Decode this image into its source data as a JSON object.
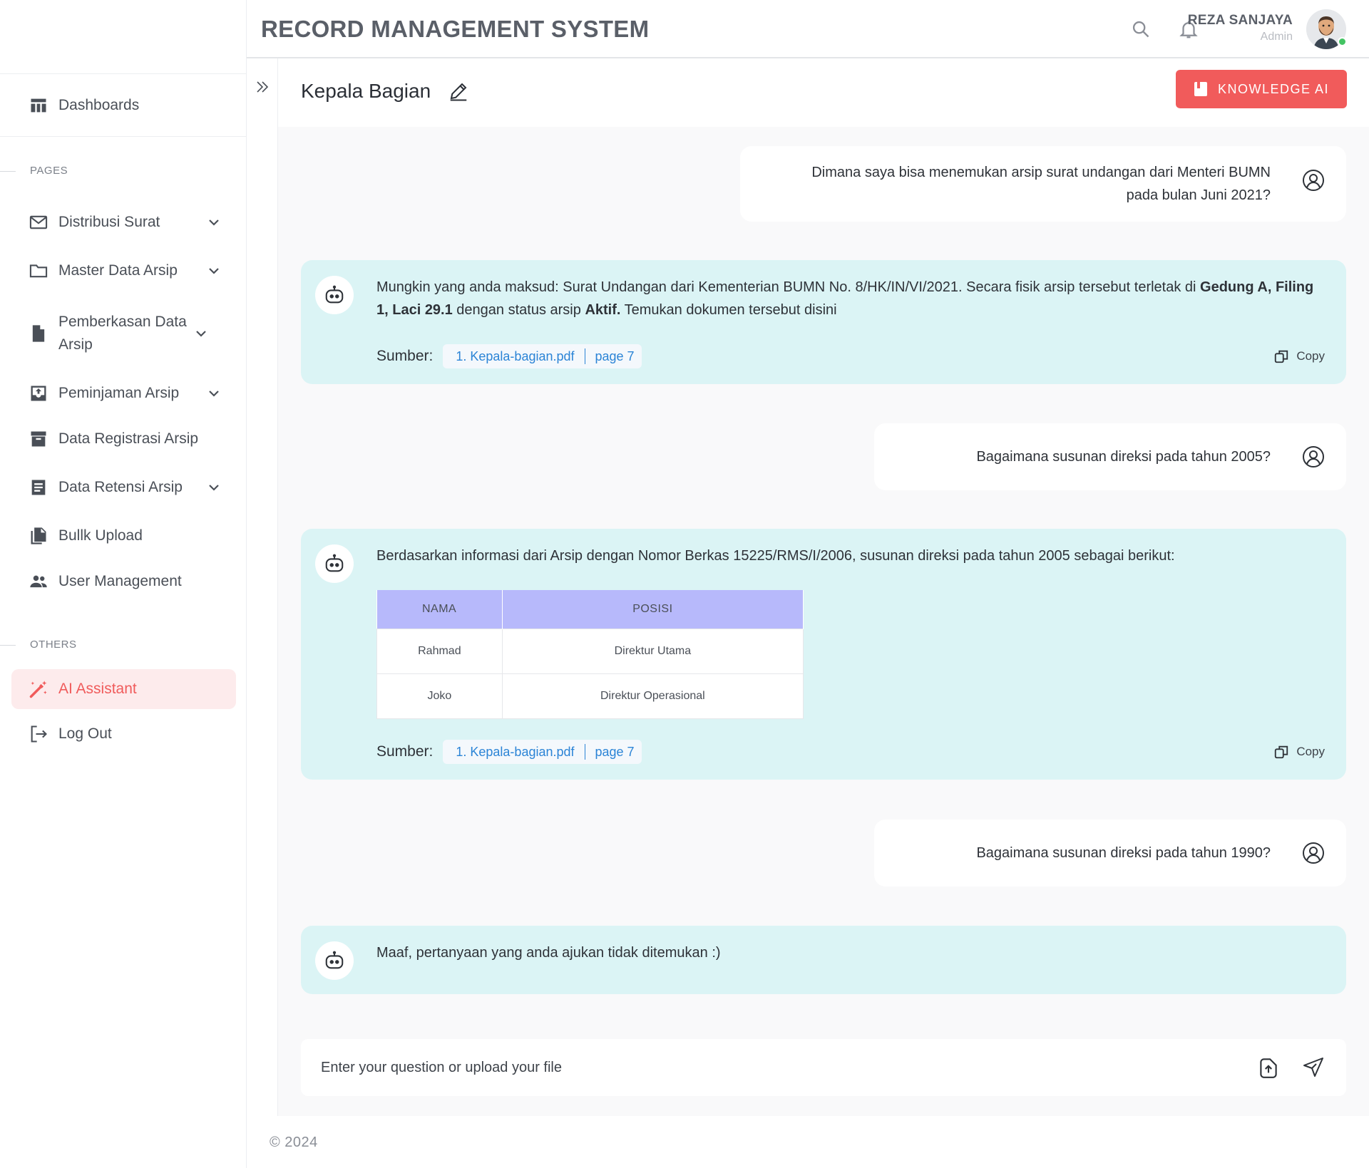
{
  "header": {
    "title": "RECORD MANAGEMENT SYSTEM",
    "user_name": "REZA SANJAYA",
    "user_role": "Admin"
  },
  "sidebar": {
    "dashboard_label": "Dashboards",
    "pages_section": "PAGES",
    "others_section": "OTHERS",
    "items": [
      {
        "label": "Distribusi Surat",
        "icon": "mail-icon",
        "has_chevron": true
      },
      {
        "label": "Master Data Arsip",
        "icon": "folder-icon",
        "has_chevron": true
      },
      {
        "label": "Pemberkasan Data Arsip",
        "icon": "file-icon",
        "has_chevron": true
      },
      {
        "label": "Peminjaman Arsip",
        "icon": "inbox-upload-icon",
        "has_chevron": true
      },
      {
        "label": "Data Registrasi Arsip",
        "icon": "archive-box-icon",
        "has_chevron": false
      },
      {
        "label": "Data Retensi Arsip",
        "icon": "document-list-icon",
        "has_chevron": true
      },
      {
        "label": "Bullk Upload",
        "icon": "files-copy-icon",
        "has_chevron": false
      },
      {
        "label": "User Management",
        "icon": "users-icon",
        "has_chevron": false
      }
    ],
    "ai_assistant_label": "AI Assistant",
    "logout_label": "Log Out"
  },
  "page": {
    "title": "Kepala Bagian",
    "knowledge_button": "KNOWLEDGE AI"
  },
  "chat": {
    "q1_line1": "Dimana saya bisa menemukan arsip surat undangan dari Menteri BUMN",
    "q1_line2": "pada bulan Juni 2021?",
    "a1_part1": "Mungkin yang anda maksud: Surat Undangan dari Kementerian BUMN No. 8/HK/IN/VI/2021. Secara fisik arsip tersebut terletak di ",
    "a1_bold1": "Gedung A, Filing 1, Laci 29.1",
    "a1_part2": " dengan status arsip ",
    "a1_bold2": "Aktif.",
    "a1_part3": "  Temukan dokumen tersebut disini",
    "q2": "Bagaimana susunan direksi pada tahun 2005?",
    "a2": "Berdasarkan informasi dari Arsip dengan Nomor Berkas 15225/RMS/I/2006, susunan direksi pada tahun 2005 sebagai berikut:",
    "table": {
      "headers": [
        "NAMA",
        "POSISI"
      ],
      "rows": [
        [
          "Rahmad",
          "Direktur Utama"
        ],
        [
          "Joko",
          "Direktur Operasional"
        ]
      ]
    },
    "q3": "Bagaimana susunan direksi pada tahun 1990?",
    "a3": "Maaf, pertanyaan yang anda ajukan tidak ditemukan :)",
    "source_label": "Sumber:",
    "source_file": "1. Kepala-bagian.pdf",
    "source_page": "page 7",
    "copy_label": "Copy"
  },
  "input": {
    "placeholder": "Enter your question or upload your file"
  },
  "footer": "© 2024",
  "colors": {
    "accent": "#f15b5b",
    "bot_bubble": "#dbf4f5",
    "table_header": "#b7b9fb",
    "link": "#2b84d6"
  }
}
